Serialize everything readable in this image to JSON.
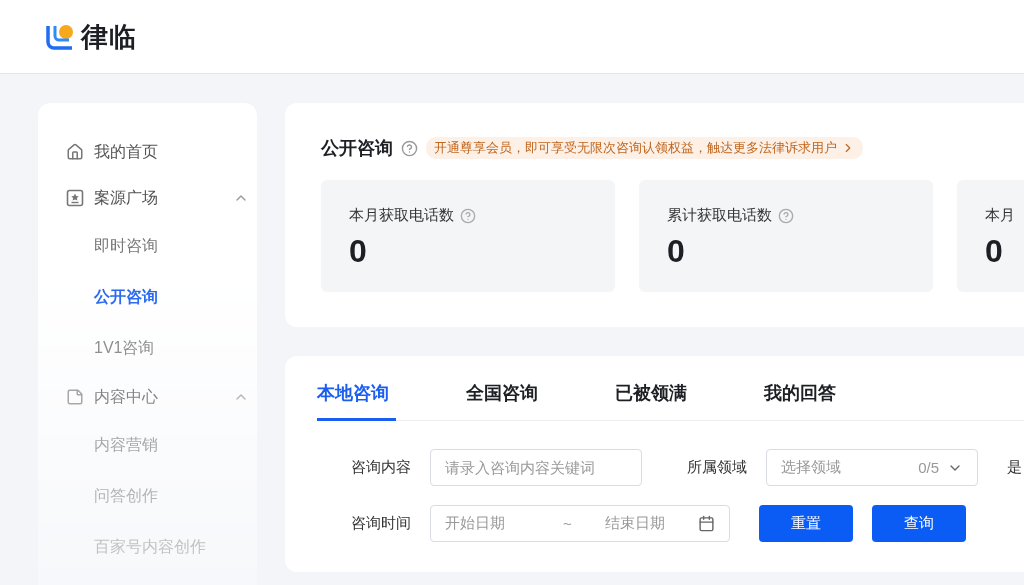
{
  "header": {
    "logo_text": "律临"
  },
  "sidebar": {
    "items": [
      {
        "kind": "link",
        "label": "我的首页",
        "selected": false
      },
      {
        "kind": "group",
        "label": "案源广场",
        "expanded": true,
        "children": [
          {
            "label": "即时咨询",
            "selected": false
          },
          {
            "label": "公开咨询",
            "selected": true
          },
          {
            "label": "1V1咨询",
            "selected": false
          }
        ]
      },
      {
        "kind": "group",
        "label": "内容中心",
        "expanded": true,
        "children": [
          {
            "label": "内容营销",
            "selected": false
          },
          {
            "label": "问答创作",
            "selected": false
          },
          {
            "label": "百家号内容创作",
            "selected": false
          }
        ]
      }
    ]
  },
  "overview": {
    "title": "公开咨询",
    "promo": "开通尊享会员，即可享受无限次咨询认领权益，触达更多法律诉求用户",
    "stats": [
      {
        "label": "本月获取电话数",
        "value": "0",
        "help": true
      },
      {
        "label": "累计获取电话数",
        "value": "0",
        "help": true
      },
      {
        "label": "本月",
        "value": "0",
        "help": false
      }
    ]
  },
  "consultations": {
    "tabs": [
      {
        "label": "本地咨询",
        "selected": true
      },
      {
        "label": "全国咨询",
        "selected": false
      },
      {
        "label": "已被领满",
        "selected": false
      },
      {
        "label": "我的回答",
        "selected": false
      }
    ],
    "filters": {
      "content": {
        "label": "咨询内容",
        "placeholder": "请录入咨询内容关键词"
      },
      "field": {
        "label": "所属领域",
        "placeholder": "选择领域",
        "count": "0/5"
      },
      "extra_label": "是",
      "time": {
        "label": "咨询时间",
        "start_placeholder": "开始日期",
        "separator": "~",
        "end_placeholder": "结束日期"
      },
      "buttons": [
        "重置",
        "查询"
      ]
    }
  }
}
